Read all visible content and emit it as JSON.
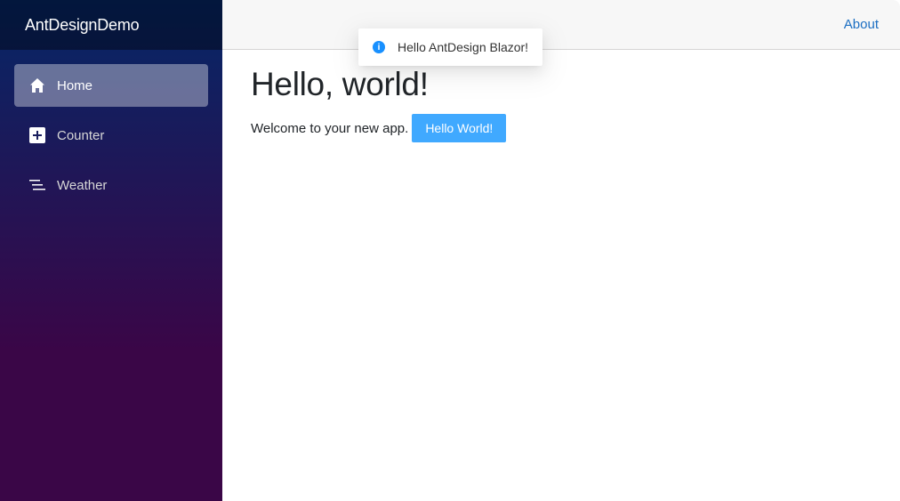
{
  "app": {
    "brand": "AntDesignDemo"
  },
  "sidebar": {
    "items": [
      {
        "label": "Home",
        "icon": "home-icon",
        "active": true
      },
      {
        "label": "Counter",
        "icon": "plus-square-icon",
        "active": false
      },
      {
        "label": "Weather",
        "icon": "list-icon",
        "active": false
      }
    ]
  },
  "header": {
    "about_label": "About"
  },
  "main": {
    "title": "Hello, world!",
    "welcome_text": "Welcome to your new app.",
    "hello_button_label": "Hello World!"
  },
  "toast": {
    "icon": "info-circle-icon",
    "message": "Hello AntDesign Blazor!"
  },
  "colors": {
    "sidebar_top": "#052767",
    "sidebar_bottom": "#3a0647",
    "link": "#1b6ec2",
    "primary_button": "#40a9ff",
    "info_icon": "#1890ff"
  }
}
